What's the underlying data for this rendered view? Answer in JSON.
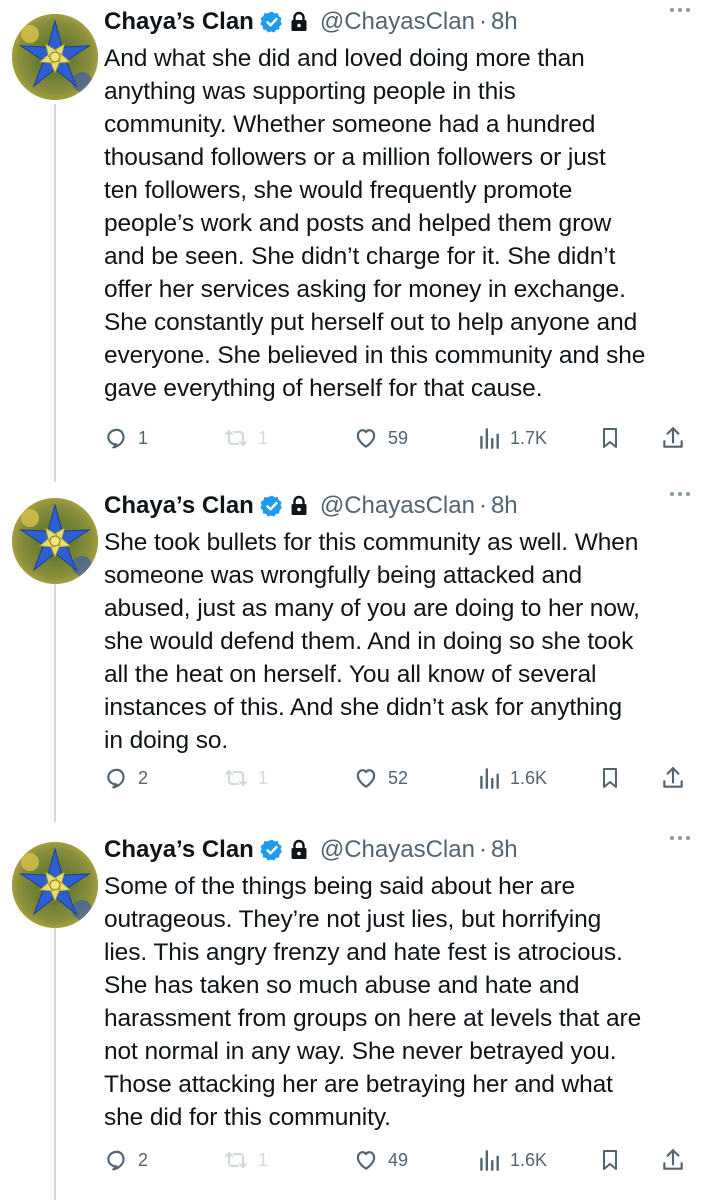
{
  "tweets": [
    {
      "author_name": "Chaya’s Clan",
      "handle": "@ChayasClan",
      "separator": "·",
      "time": "8h",
      "lines": [
        "And what she did and loved doing more than",
        "anything was supporting people in this",
        "community. Whether someone had a hundred",
        "thousand followers or a million followers or just",
        "ten followers, she would frequently promote",
        "people’s work and posts and helped them grow",
        "and be seen. She didn’t charge for it. She didn’t",
        "offer her services asking for money in exchange.",
        "She constantly put herself out to help anyone and",
        "everyone. She believed in this community and she",
        "gave everything of herself for that cause."
      ],
      "replies": "1",
      "reposts": "1",
      "likes": "59",
      "views": "1.7K"
    },
    {
      "author_name": "Chaya’s Clan",
      "handle": "@ChayasClan",
      "separator": "·",
      "time": "8h",
      "lines": [
        "She took bullets for this community as well. When",
        "someone was wrongfully being attacked and",
        "abused, just as many of you are doing to her now,",
        "she would defend them. And in doing so she took",
        "all the heat on herself. You all know of several",
        "instances of this. And she didn’t ask for anything",
        "in doing so."
      ],
      "replies": "2",
      "reposts": "1",
      "likes": "52",
      "views": "1.6K"
    },
    {
      "author_name": "Chaya’s Clan",
      "handle": "@ChayasClan",
      "separator": "·",
      "time": "8h",
      "lines": [
        "Some of the things being said about her are",
        "outrageous. They’re not just lies, but horrifying",
        "lies. This angry frenzy and hate fest is atrocious.",
        "She has taken so much abuse and hate and",
        "harassment from groups on here at levels that are",
        "not normal in any way. She never betrayed you.",
        "Those attacking her are betraying her and what",
        "she did for this community."
      ],
      "replies": "2",
      "reposts": "1",
      "likes": "49",
      "views": "1.6K"
    }
  ],
  "colors": {
    "verified_badge": "#1d9bf0",
    "secondary_text": "#536471",
    "thread_line": "#cfd9de"
  },
  "icons": [
    "avatar-flower",
    "verified-badge-icon",
    "lock-icon",
    "more-icon",
    "reply-icon",
    "repost-icon",
    "like-icon",
    "views-icon",
    "bookmark-icon",
    "share-icon"
  ]
}
